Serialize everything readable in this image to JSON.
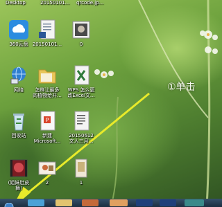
{
  "top_labels": [
    "Desktop",
    "20150101...",
    "qrcode.jp..."
  ],
  "icons": [
    {
      "label": "360云盘",
      "icon": "cloud-icon"
    },
    {
      "label": "20150101...",
      "icon": "word-doc-icon"
    },
    {
      "label": "0",
      "icon": "image-file-icon"
    },
    {
      "label": "网络",
      "icon": "network-icon"
    },
    {
      "label": "怎样让最多\n肉植物给开...",
      "icon": "folder-icon"
    },
    {
      "label": "WPS 怎么更\n改Excel文...",
      "icon": "excel-doc-icon"
    },
    {
      "label": "回收站",
      "icon": "recycle-bin-icon"
    },
    {
      "label": "新建\nMicrosoft...",
      "icon": "wps-doc-icon"
    },
    {
      "label": "20150612\n文人三月...",
      "icon": "text-doc-icon"
    },
    {
      "label": "(姐妹肚皮\n舞)",
      "icon": "video-file-icon"
    },
    {
      "label": "2",
      "icon": "image-thumb-icon"
    },
    {
      "label": "1",
      "icon": "image-thumb-icon"
    }
  ],
  "callout": "①单击",
  "taskbar": {
    "start": "start-orb-icon"
  }
}
